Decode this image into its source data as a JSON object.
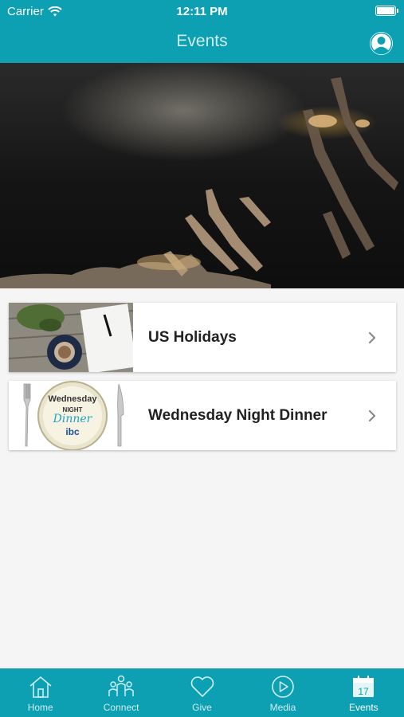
{
  "status_bar": {
    "carrier": "Carrier",
    "time": "12:11 PM"
  },
  "header": {
    "title": "Events",
    "profile_icon": "person-circle-icon"
  },
  "events": [
    {
      "title": "US Holidays",
      "thumbnail": "coffee-notebook-photo"
    },
    {
      "title": "Wednesday Night Dinner",
      "thumbnail": "plate-fork-knife-logo",
      "logo_text": {
        "line1": "Wednesday",
        "line2": "NIGHT",
        "line3": "Dinner",
        "brand": "ibc"
      }
    }
  ],
  "tabs": [
    {
      "label": "Home",
      "icon": "house-icon",
      "active": false
    },
    {
      "label": "Connect",
      "icon": "people-icon",
      "active": false
    },
    {
      "label": "Give",
      "icon": "heart-icon",
      "active": false
    },
    {
      "label": "Media",
      "icon": "play-circle-icon",
      "active": false
    },
    {
      "label": "Events",
      "icon": "calendar-icon",
      "active": true,
      "calendar_day": "17"
    }
  ],
  "colors": {
    "brand": "#0d9fb2",
    "background": "#f5f5f5",
    "tab_inactive": "#cdeef3",
    "tab_active": "#ffffff"
  }
}
